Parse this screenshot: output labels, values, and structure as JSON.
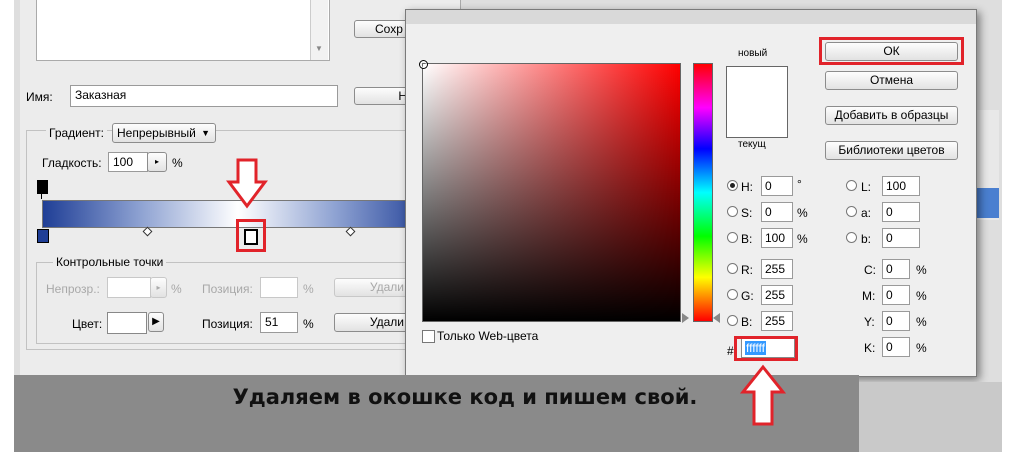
{
  "gradient_editor": {
    "save_button": "Сохр",
    "name_label": "Имя:",
    "name_value": "Заказная",
    "new_button": "Н",
    "gradient_type_label": "Градиент:",
    "gradient_type_value": "Непрерывный",
    "smoothness_label": "Гладкость:",
    "smoothness_value": "100",
    "smoothness_unit": "%",
    "stops_group_label": "Контрольные точки",
    "opacity_label": "Непрозр.:",
    "opacity_unit": "%",
    "position_label": "Позиция:",
    "position_unit": "%",
    "delete_button": "Удали",
    "color_label": "Цвет:",
    "color_value": "#ffffff",
    "color_position_label": "Позиция:",
    "color_position_value": "51",
    "color_position_unit": "%",
    "delete_button_2": "Удали"
  },
  "color_picker": {
    "title": "",
    "new_label": "новый",
    "current_label": "текущ",
    "current_color": "#ffffff",
    "ok_button": "ОК",
    "cancel_button": "Отмена",
    "add_swatches_button": "Добавить в образцы",
    "libraries_button": "Библиотеки цветов",
    "web_only_label": "Только Web-цвета",
    "hsb": [
      {
        "label": "H:",
        "value": "0",
        "unit": "°",
        "selected": true
      },
      {
        "label": "S:",
        "value": "0",
        "unit": "%",
        "selected": false
      },
      {
        "label": "B:",
        "value": "100",
        "unit": "%",
        "selected": false
      }
    ],
    "rgb": [
      {
        "label": "R:",
        "value": "255"
      },
      {
        "label": "G:",
        "value": "255"
      },
      {
        "label": "B:",
        "value": "255"
      }
    ],
    "lab": [
      {
        "label": "L:",
        "value": "100"
      },
      {
        "label": "a:",
        "value": "0"
      },
      {
        "label": "b:",
        "value": "0"
      }
    ],
    "cmyk": [
      {
        "label": "C:",
        "value": "0",
        "unit": "%"
      },
      {
        "label": "M:",
        "value": "0",
        "unit": "%"
      },
      {
        "label": "Y:",
        "value": "0",
        "unit": "%"
      },
      {
        "label": "K:",
        "value": "0",
        "unit": "%"
      }
    ],
    "hex_label": "#",
    "hex_value": "ffffff"
  },
  "caption": "Удаляем в окошке код и пишем свой.",
  "colors": {
    "highlight": "#e1232a",
    "gradient_dark": "#1f3e96"
  }
}
